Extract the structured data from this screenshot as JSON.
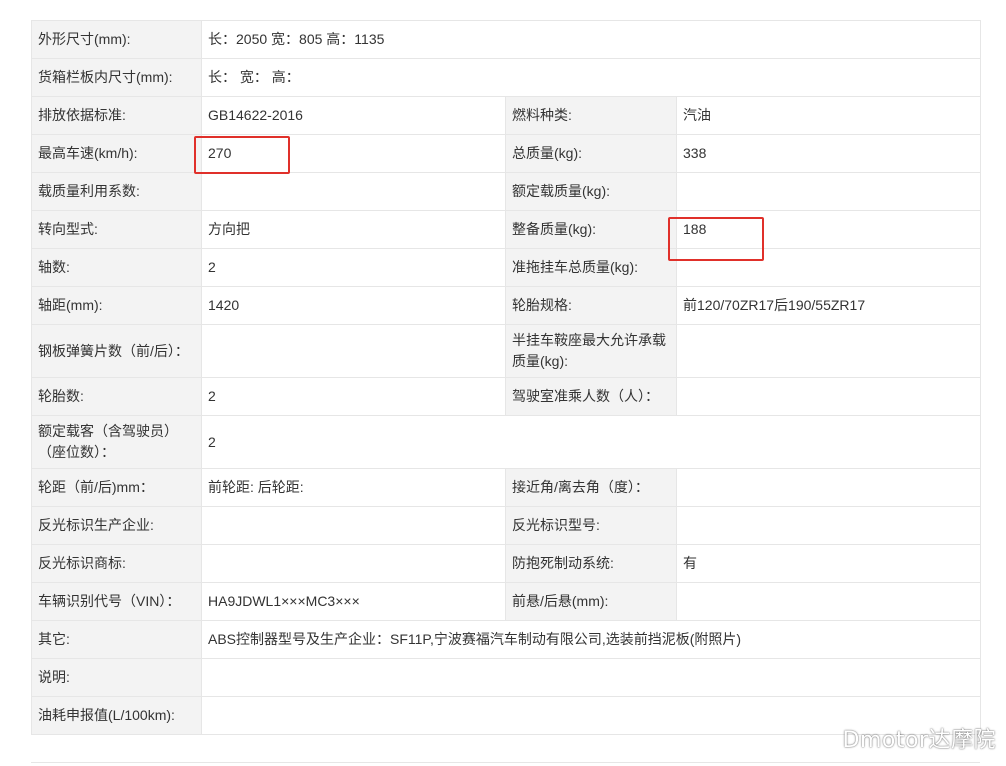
{
  "rows": [
    {
      "k1": "外形尺寸(mm):",
      "v1": "长：2050 宽：805 高：1135"
    },
    {
      "k1": "货箱栏板内尺寸(mm):",
      "v1": "长：  宽：  高："
    },
    {
      "k1": "排放依据标准:",
      "v1": "GB14622-2016",
      "k2": "燃料种类:",
      "v2": "汽油"
    },
    {
      "k1": "最高车速(km/h):",
      "v1": "270",
      "k2": "总质量(kg):",
      "v2": "338"
    },
    {
      "k1": "载质量利用系数:",
      "v1": "",
      "k2": "额定载质量(kg):",
      "v2": ""
    },
    {
      "k1": "转向型式:",
      "v1": "方向把",
      "k2": "整备质量(kg):",
      "v2": "188"
    },
    {
      "k1": "轴数:",
      "v1": "2",
      "k2": "准拖挂车总质量(kg):",
      "v2": ""
    },
    {
      "k1": "轴距(mm):",
      "v1": "1420",
      "k2": "轮胎规格:",
      "v2": "前120/70ZR17后190/55ZR17"
    },
    {
      "k1": "钢板弹簧片数（前/后）：",
      "v1": "",
      "k2": "半挂车鞍座最大允许承载质量(kg):",
      "v2": ""
    },
    {
      "k1": "轮胎数:",
      "v1": "2",
      "k2": "驾驶室准乘人数（人）：",
      "v2": ""
    },
    {
      "k1": "额定载客（含驾驶员）（座位数）：",
      "v1": "2"
    },
    {
      "k1": "轮距（前/后)mm：",
      "v1": "前轮距: 后轮距:",
      "k2": "接近角/离去角（度）：",
      "v2": ""
    },
    {
      "k1": "反光标识生产企业:",
      "v1": "",
      "k2": "反光标识型号:",
      "v2": ""
    },
    {
      "k1": "反光标识商标:",
      "v1": "",
      "k2": "防抱死制动系统:",
      "v2": "有"
    },
    {
      "k1": "车辆识别代号（VIN）：",
      "v1": "HA9JDWL1×××MC3×××",
      "k2": "前悬/后悬(mm):",
      "v2": ""
    },
    {
      "k1": "其它:",
      "v1": "ABS控制器型号及生产企业：SF11P,宁波赛福汽车制动有限公司,选装前挡泥板(附照片)"
    },
    {
      "k1": "说明:",
      "v1": ""
    },
    {
      "k1": "油耗申报值(L/100km):",
      "v1": ""
    }
  ],
  "watermark": "Dmotor达摩院",
  "colors": {
    "highlight": "#e0302a",
    "label_bg": "#f3f3f3",
    "border": "#e6e6e6"
  }
}
